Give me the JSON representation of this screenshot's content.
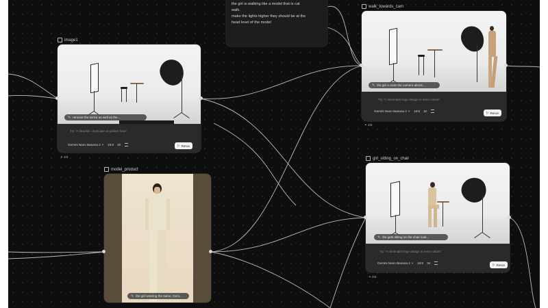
{
  "text_node": {
    "lines": [
      "the girl is walking like a model that is cat",
      "walk.",
      "make the lights higher they should be at the",
      "head level of the model"
    ]
  },
  "nodes": {
    "image1": {
      "title": "image1",
      "prompt_chip": "remove the mirror as well as the ...",
      "hint": "Try \"A futuristic cityscape at golden hour\"",
      "model": "Gemini Nano Banana 2",
      "ratio": "16:9",
      "resolution": "1K",
      "rerun": "Rerun",
      "link_count": "2/4"
    },
    "walk_towards_camera": {
      "title": "walk_towards_cam",
      "prompt_chip": "the girl is near the camera almos...",
      "hint": "Try \"A minimalist logo design in neon colors\"",
      "model": "Gemini Nano Banana 2",
      "ratio": "16:9",
      "resolution": "1K",
      "rerun": "Rerun",
      "link_count": "2/4"
    },
    "model_product": {
      "title": "model_product",
      "prompt_chip": "the girl wearing the same, Gem..."
    },
    "girl_sitting_on_chair": {
      "title": "girl_sitting_on_chair",
      "prompt_chip": "the girls sitting on the chair look...",
      "hint": "Try \"A minimalist logo design in neon colors\"",
      "model": "Gemini Nano Banana 2",
      "ratio": "16:9",
      "resolution": "1K",
      "rerun": "Rerun",
      "link_count": "2/4"
    }
  },
  "icons": {
    "title_icon": "image-node-icon",
    "chip_icon": "pencil-icon",
    "rerun_icon": "play-icon",
    "link_icon": "link-icon",
    "settings_icon": "sliders-icon"
  },
  "colors": {
    "canvas": "#0e0e0e",
    "card": "#2a2a2a",
    "wire": "#e0e0e0",
    "button": "#f2f2f2"
  }
}
